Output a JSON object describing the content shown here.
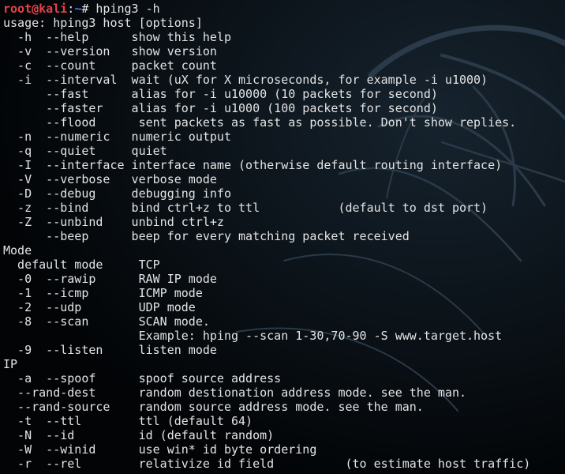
{
  "colors": {
    "background": "#020406",
    "text": "#e4e4e4",
    "prompt_user": "#e8414a",
    "prompt_path": "#3c7fe0"
  },
  "prompt": {
    "user_host": "root@kali",
    "separator": ":",
    "path": "~",
    "symbol": "# ",
    "command": "hping3 -h"
  },
  "output_lines": [
    "usage: hping3 host [options]",
    "  -h  --help      show this help",
    "  -v  --version   show version",
    "  -c  --count     packet count",
    "  -i  --interval  wait (uX for X microseconds, for example -i u1000)",
    "      --fast      alias for -i u10000 (10 packets for second)",
    "      --faster    alias for -i u1000 (100 packets for second)",
    "      --flood      sent packets as fast as possible. Don't show replies.",
    "  -n  --numeric   numeric output",
    "  -q  --quiet     quiet",
    "  -I  --interface interface name (otherwise default routing interface)",
    "  -V  --verbose   verbose mode",
    "  -D  --debug     debugging info",
    "  -z  --bind      bind ctrl+z to ttl           (default to dst port)",
    "  -Z  --unbind    unbind ctrl+z",
    "      --beep      beep for every matching packet received",
    "Mode",
    "  default mode     TCP",
    "  -0  --rawip      RAW IP mode",
    "  -1  --icmp       ICMP mode",
    "  -2  --udp        UDP mode",
    "  -8  --scan       SCAN mode.",
    "                   Example: hping --scan 1-30,70-90 -S www.target.host",
    "  -9  --listen     listen mode",
    "IP",
    "  -a  --spoof      spoof source address",
    "  --rand-dest      random destionation address mode. see the man.",
    "  --rand-source    random source address mode. see the man.",
    "  -t  --ttl        ttl (default 64)",
    "  -N  --id         id (default random)",
    "  -W  --winid      use win* id byte ordering",
    "  -r  --rel        relativize id field          (to estimate host traffic)"
  ]
}
